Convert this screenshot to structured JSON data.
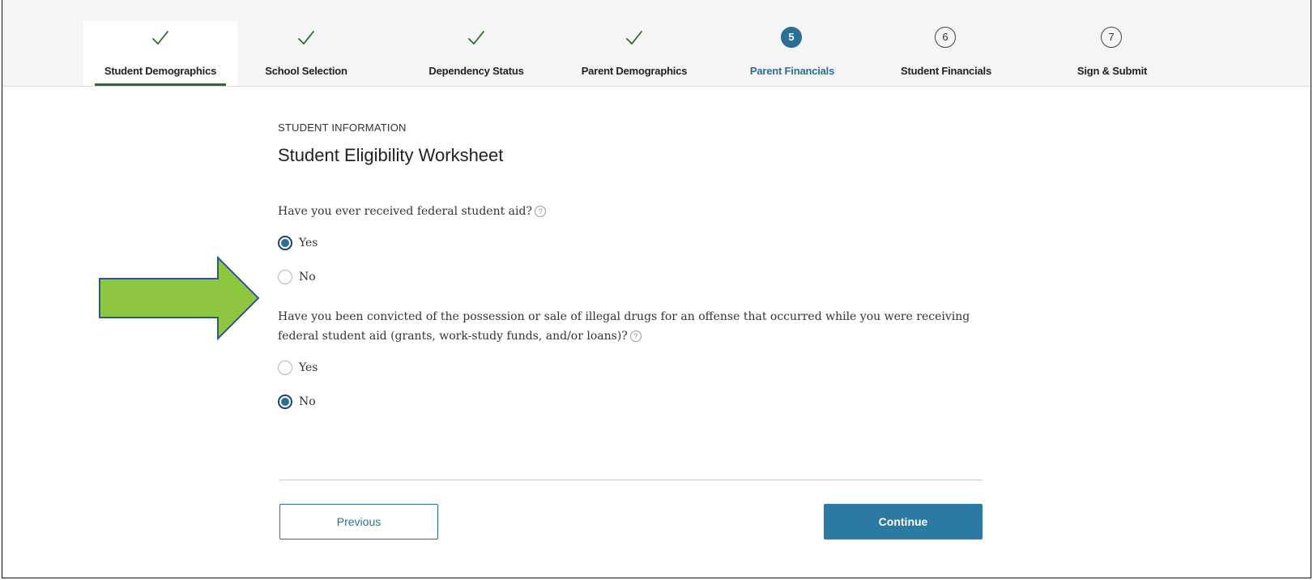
{
  "stepper": {
    "steps": [
      {
        "label": "Student Demographics",
        "marker": "check-icon"
      },
      {
        "label": "School Selection",
        "marker": "check-icon"
      },
      {
        "label": "Dependency Status",
        "marker": "check-icon"
      },
      {
        "label": "Parent Demographics",
        "marker": "check-icon"
      },
      {
        "label": "Parent Financials",
        "number": "5"
      },
      {
        "label": "Student Financials",
        "number": "6"
      },
      {
        "label": "Sign & Submit",
        "number": "7"
      }
    ]
  },
  "page": {
    "eyebrow": "STUDENT INFORMATION",
    "title": "Student Eligibility Worksheet"
  },
  "questions": [
    {
      "text": "Have you ever received federal student aid?",
      "options": [
        {
          "label": "Yes",
          "selected": true
        },
        {
          "label": "No",
          "selected": false
        }
      ]
    },
    {
      "text": "Have you been convicted of the possession or sale of illegal drugs for an offense that occurred while you were receiving federal student aid (grants, work-study funds, and/or loans)?",
      "options": [
        {
          "label": "Yes",
          "selected": false
        },
        {
          "label": "No",
          "selected": true
        }
      ]
    }
  ],
  "help_icon_glyph": "?",
  "buttons": {
    "previous": "Previous",
    "continue": "Continue"
  },
  "colors": {
    "accent": "#2a6f97",
    "check": "#2e6b2e",
    "annotation_arrow_fill": "#8dc63f",
    "annotation_arrow_stroke": "#2f5597"
  }
}
